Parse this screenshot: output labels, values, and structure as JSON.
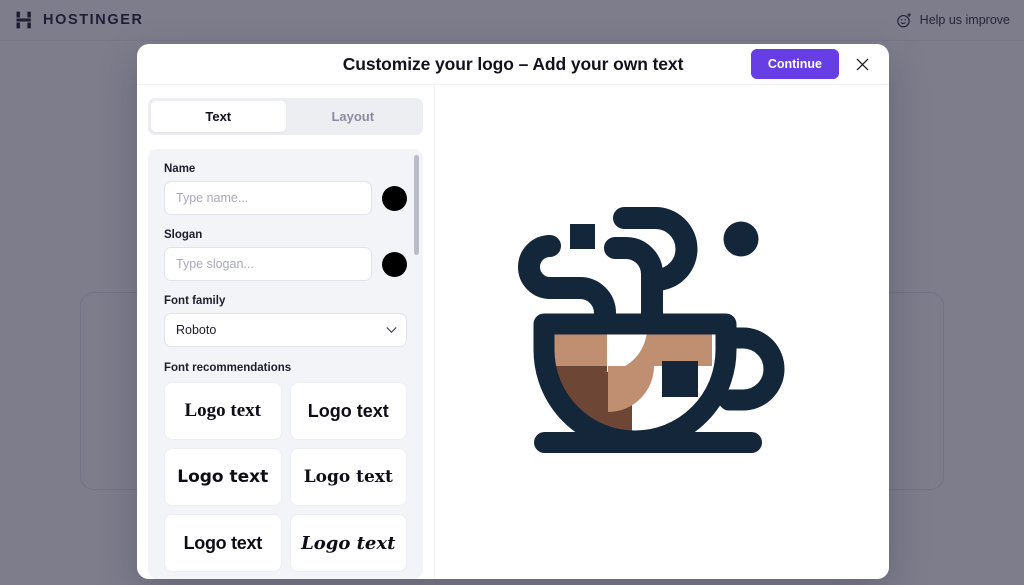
{
  "topbar": {
    "brand_name": "HOSTINGER",
    "brand_icon": "hostinger-h-mark",
    "help_label": "Help us improve",
    "help_icon": "smiley-plus-icon"
  },
  "modal": {
    "title": "Customize your logo – Add your own text",
    "continue_label": "Continue",
    "close_icon": "close-x-icon"
  },
  "tabs": [
    {
      "label": "Text",
      "active": true
    },
    {
      "label": "Layout",
      "active": false
    }
  ],
  "form": {
    "name": {
      "label": "Name",
      "placeholder": "Type name...",
      "value": "",
      "color": "#000000"
    },
    "slogan": {
      "label": "Slogan",
      "placeholder": "Type slogan...",
      "value": "",
      "color": "#000000"
    },
    "font_family": {
      "label": "Font family",
      "selected": "Roboto",
      "chevron_icon": "chevron-down-icon"
    },
    "font_recommendations": {
      "label": "Font recommendations",
      "cards": [
        {
          "sample": "Logo text",
          "style": "serif-display"
        },
        {
          "sample": "Logo text",
          "style": "sans-bold"
        },
        {
          "sample": "Logo text",
          "style": "sans-grotesk"
        },
        {
          "sample": "Logo text",
          "style": "slab-serif"
        },
        {
          "sample": "Logo text",
          "style": "sans-condensed"
        },
        {
          "sample": "Logo text",
          "style": "script"
        }
      ]
    }
  },
  "preview": {
    "logo_name": "coffee-cup-logo",
    "colors": {
      "dark": "#14263A",
      "tan": "#C08F72",
      "brown": "#6E4636",
      "accent_purple": "#673DE6",
      "overlay": "#211F38"
    }
  },
  "background_cards": [
    {
      "logo_name": "coffee-cup-logo-variant-left"
    },
    {
      "logo_name": "coffee-cup-logo-variant-right"
    }
  ]
}
